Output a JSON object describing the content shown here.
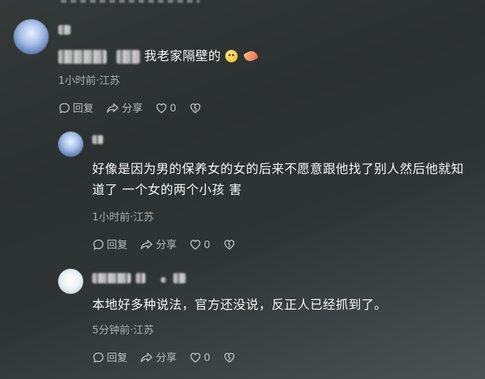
{
  "comments": [
    {
      "text": "我老家隔壁的",
      "meta": "1小时前·江苏",
      "reply_label": "回复",
      "share_label": "分享",
      "like_count": "0"
    },
    {
      "text": "好像是因为男的保养女的女的后来不愿意跟他找了别人然后他就知道了 一个女的两个小孩 害",
      "meta": "1小时前·江苏",
      "reply_label": "回复",
      "share_label": "分享",
      "like_count": "0"
    },
    {
      "text": "本地好多种说法，官方还没说，反正人已经抓到了。",
      "meta": "5分钟前·江苏",
      "reply_label": "回复",
      "share_label": "分享",
      "like_count": "0"
    }
  ],
  "icons": {
    "reply": "comment-bubble-icon",
    "share": "share-arrow-icon",
    "like": "heart-icon",
    "dislike": "broken-heart-icon",
    "emoji_smile": "smile-emoji-icon",
    "emoji_extra": "sticker-emoji-icon"
  }
}
